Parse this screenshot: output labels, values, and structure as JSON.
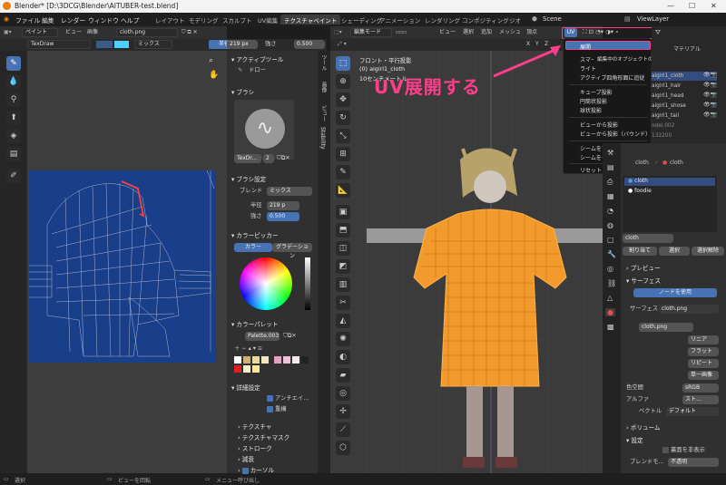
{
  "window": {
    "title": "Blender* [D:\\3DCG\\Blender\\AITUBER-test.blend]",
    "controls": [
      "—",
      "☐",
      "✕"
    ]
  },
  "menus": [
    "ファイル",
    "編集",
    "レンダー",
    "ウィンドウ",
    "ヘルプ"
  ],
  "workspace_tabs": [
    "レイアウト",
    "モデリング",
    "スカルプト",
    "UV編集",
    "テクスチャペイント",
    "シェーディング",
    "アニメーション",
    "レンダリング",
    "コンポジティング",
    "ジオ"
  ],
  "scene": {
    "label": "Scene",
    "view_layer": "ViewLayer"
  },
  "image_editor": {
    "mode": "ペイント",
    "view": "ビュー",
    "image": "画像",
    "image_name": "cloth.png",
    "brush_name": "TexDraw",
    "blend_mode": "ミックス",
    "radius_label": "半径",
    "radius_value": "219 px",
    "strength_label": "強さ",
    "strength_value": "0.500"
  },
  "properties_tool": {
    "active_tool_title": "アクティブツール",
    "active_tool": "ドロー",
    "brush_title": "ブラシ",
    "brush_name": "TexDr...",
    "brush_users": "2",
    "brush_settings_title": "ブラシ設定",
    "blend_label": "ブレンド",
    "blend_value": "ミックス",
    "radius_label": "半径",
    "radius_value": "219 p",
    "strength_label": "強さ",
    "strength_value": "0.500",
    "color_picker_title": "カラーピッカー",
    "color_tab": "カラー",
    "gradient_tab": "グラデーション",
    "palette_title": "カラーパレット",
    "palette_name": "Palette.003",
    "advanced_title": "詳細設定",
    "antialias": "アンチエイ...",
    "falloff": "重構",
    "texture": "テクスチャ",
    "texture_mask": "テクスチャマスク",
    "stroke": "ストローク",
    "attenuation": "減衰",
    "cursor": "カーソル"
  },
  "side_tabs": [
    "ツール",
    "画像",
    "ビュー",
    "Stability"
  ],
  "viewport": {
    "mode": "編集モード",
    "view": "ビュー",
    "select": "選択",
    "add": "追加",
    "mesh": "メッシュ",
    "vertex": "頂点",
    "uv_menu": "UV",
    "info_line1": "フロント・平行投影",
    "info_line2": "(0) aigirl1_cloth",
    "info_line3": "10センチメートル",
    "axes": [
      "X",
      "Y",
      "Z"
    ]
  },
  "uv_menu": {
    "items": [
      "展開",
      "スマー",
      "ライト",
      "アクティブ四角形面に追従",
      "キューブ投影",
      "円筒状投影",
      "球状投影",
      "ビューから投影",
      "ビューから投影（バウンド）",
      "シームをマーク",
      "シームをクリア",
      "リセット"
    ],
    "tooltip": "編集中のオブジェクトのメッシュを展開します。"
  },
  "callout": "UV展開する",
  "outliner": {
    "header": "マテリアル",
    "rows": [
      "aigirl1_cloth",
      "aigirl1_hair",
      "aigirl1_head",
      "aigirl1_shose",
      "aigirl1_tail",
      "odel.002",
      "132200"
    ]
  },
  "material_props": {
    "breadcrumb_obj": "cloth",
    "breadcrumb_mat": "cloth",
    "slots": [
      "cloth",
      "foodie"
    ],
    "mat_name": "cloth",
    "assign": "割り当て",
    "select": "選択",
    "deselect": "選択解除",
    "preview": "プレビュー",
    "surface": "サーフェス",
    "use_nodes": "ノードを使用",
    "surface_label": "サーフェス",
    "surface_value": "cloth.png",
    "image_name": "cloth.png",
    "interp": "リニア",
    "projection": "フラット",
    "extension": "リピート",
    "single_image": "単一画像",
    "color_space_label": "色空間",
    "color_space": "sRGB",
    "alpha_label": "アルファ",
    "alpha": "スト...",
    "vector_label": "ベクトル",
    "vector": "デフォルト",
    "volume": "ボリューム",
    "settings": "設定",
    "backface": "裏面を非表示",
    "blend_mode_label": "ブレンドモ...",
    "blend_mode": "不透明",
    "shadow_label": "影のモード",
    "shadow": "不透明"
  },
  "status": [
    "選択",
    "ビューを回転",
    "メニュー呼び出し"
  ]
}
